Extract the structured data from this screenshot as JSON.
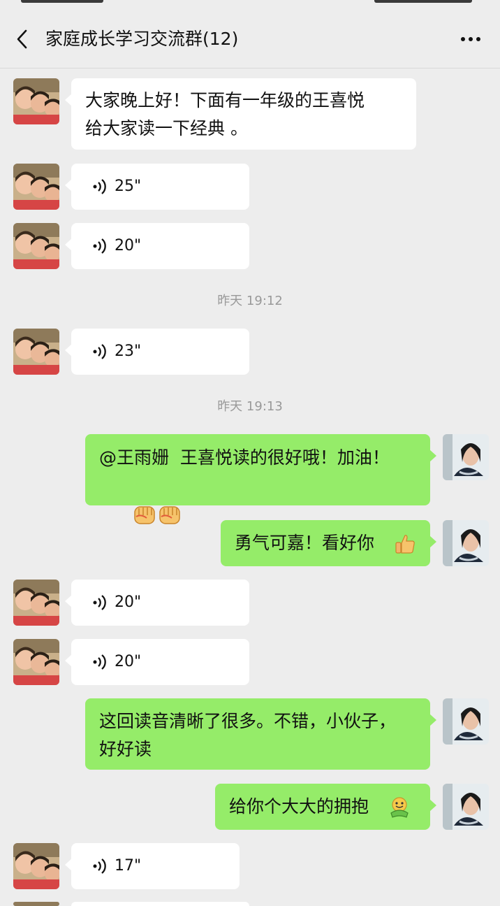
{
  "header": {
    "title": "家庭成长学习交流群(12)",
    "back_icon": "chevron-left-icon",
    "more_icon": "ellipsis-icon"
  },
  "timestamps": [
    "昨天 19:12",
    "昨天 19:13"
  ],
  "messages": [
    {
      "side": "left",
      "type": "text",
      "line1": "大家晚上好！下面有一年级的王喜悦",
      "line2": "给大家读一下经典 。"
    },
    {
      "side": "left",
      "type": "voice",
      "duration": "25\""
    },
    {
      "side": "left",
      "type": "voice",
      "duration": "20\""
    },
    {
      "side": "left",
      "type": "voice",
      "duration": "23\""
    },
    {
      "side": "right",
      "type": "text",
      "line1": "@王雨姗  王喜悦读的很好哦！加油！",
      "emoji": "raised-fist-emoji"
    },
    {
      "side": "right",
      "type": "text",
      "line1": "勇气可嘉！看好你",
      "emoji": "thumbs-up-emoji"
    },
    {
      "side": "left",
      "type": "voice",
      "duration": "20\""
    },
    {
      "side": "left",
      "type": "voice",
      "duration": "20\""
    },
    {
      "side": "right",
      "type": "text",
      "line1": "这回读音清晰了很多。不错，小伙子，",
      "line2": "好好读"
    },
    {
      "side": "right",
      "type": "text",
      "line1": "给你个大大的拥抱",
      "emoji": "hug-emoji"
    },
    {
      "side": "left",
      "type": "voice",
      "duration": "17\""
    }
  ],
  "colors": {
    "background": "#ededed",
    "incoming_bubble": "#ffffff",
    "outgoing_bubble": "#95ec69",
    "timestamp_text": "#999999"
  }
}
